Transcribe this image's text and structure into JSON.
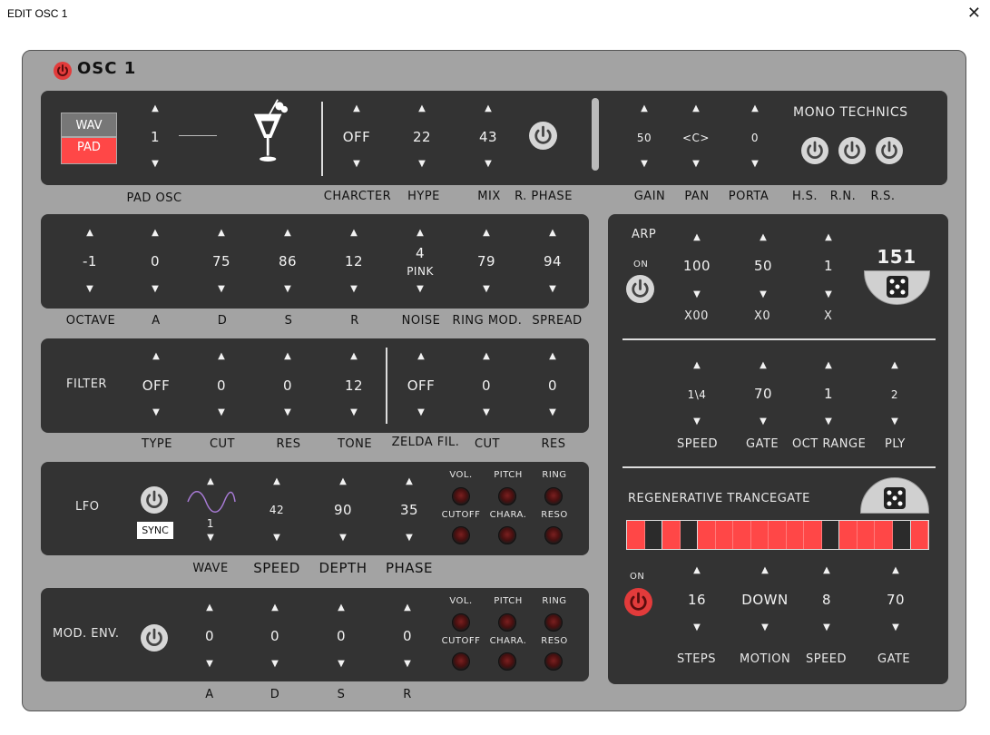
{
  "window": {
    "title": "EDIT OSC 1",
    "close": "✕"
  },
  "header": {
    "title": "OSC 1"
  },
  "osc": {
    "wav_label": "WAV",
    "pad_label": "PAD",
    "pad_value": "1",
    "pad_osc_label": "PAD OSC",
    "charcter_value": "OFF",
    "hype_value": "22",
    "mix_value": "43",
    "charcter_label": "CHARCTER",
    "hype_label": "HYPE",
    "mix_label": "MIX",
    "rphase_label": "R. PHASE",
    "gain_value": "50",
    "pan_value": "<C>",
    "porta_value": "0",
    "gain_label": "GAIN",
    "pan_label": "PAN",
    "porta_label": "PORTA",
    "mono_label": "MONO TECHNICS",
    "hs_label": "H.S.",
    "rn_label": "R.N.",
    "rs_label": "R.S."
  },
  "env": {
    "octave": "-1",
    "a": "0",
    "d": "75",
    "s": "86",
    "r": "12",
    "noise": "4",
    "noise_type": "PINK",
    "ring": "79",
    "spread": "94",
    "octave_label": "OCTAVE",
    "a_label": "A",
    "d_label": "D",
    "s_label": "S",
    "r_label": "R",
    "noise_label": "NOISE",
    "ring_label": "RING MOD.",
    "spread_label": "SPREAD"
  },
  "filter": {
    "title": "FILTER",
    "type": "OFF",
    "cut": "0",
    "res": "0",
    "tone": "12",
    "zelda": "OFF",
    "zcut": "0",
    "zres": "0",
    "type_label": "TYPE",
    "cut_label": "CUT",
    "res_label": "RES",
    "tone_label": "TONE",
    "zelda_label": "ZELDA FIL.",
    "zcut_label": "CUT",
    "zres_label": "RES"
  },
  "lfo": {
    "title": "LFO",
    "sync": "SYNC",
    "wave": "1",
    "speed": "42",
    "depth": "90",
    "phase": "35",
    "wave_label": "WAVE",
    "speed_label": "SPEED",
    "depth_label": "DEPTH",
    "phase_label": "PHASE",
    "k_vol": "VOL.",
    "k_pitch": "PITCH",
    "k_ring": "RING",
    "k_cutoff": "CUTOFF",
    "k_chara": "CHARA.",
    "k_reso": "RESO"
  },
  "modenv": {
    "title": "MOD. ENV.",
    "a": "0",
    "d": "0",
    "s": "0",
    "r": "0",
    "a_label": "A",
    "d_label": "D",
    "s_label": "S",
    "r_label": "R",
    "k_vol": "VOL.",
    "k_pitch": "PITCH",
    "k_ring": "RING",
    "k_cutoff": "CUTOFF",
    "k_chara": "CHARA.",
    "k_reso": "RESO"
  },
  "arp": {
    "title": "ARP",
    "on": "ON",
    "x00": "100",
    "x0": "50",
    "x": "1",
    "seed": "151",
    "x00_label": "X00",
    "x0_label": "X0",
    "x_label": "X",
    "speed": "1\\4",
    "gate": "70",
    "oct": "1",
    "ply": "2",
    "speed_label": "SPEED",
    "gate_label": "GATE",
    "oct_label": "OCT RANGE",
    "ply_label": "PLY"
  },
  "trance": {
    "title": "REGENERATIVE TRANCEGATE",
    "on": "ON",
    "steps_pattern": [
      1,
      0,
      1,
      0,
      1,
      1,
      1,
      1,
      1,
      1,
      1,
      0,
      1,
      1,
      1,
      0,
      1
    ],
    "steps": "16",
    "motion": "DOWN",
    "speed": "8",
    "gate": "70",
    "steps_label": "STEPS",
    "motion_label": "MOTION",
    "speed_label": "SPEED",
    "gate_label": "GATE"
  },
  "colors": {
    "panel": "#333333",
    "bg": "#a3a3a3",
    "active": "#ff4747",
    "power_red": "#e23b3b"
  }
}
